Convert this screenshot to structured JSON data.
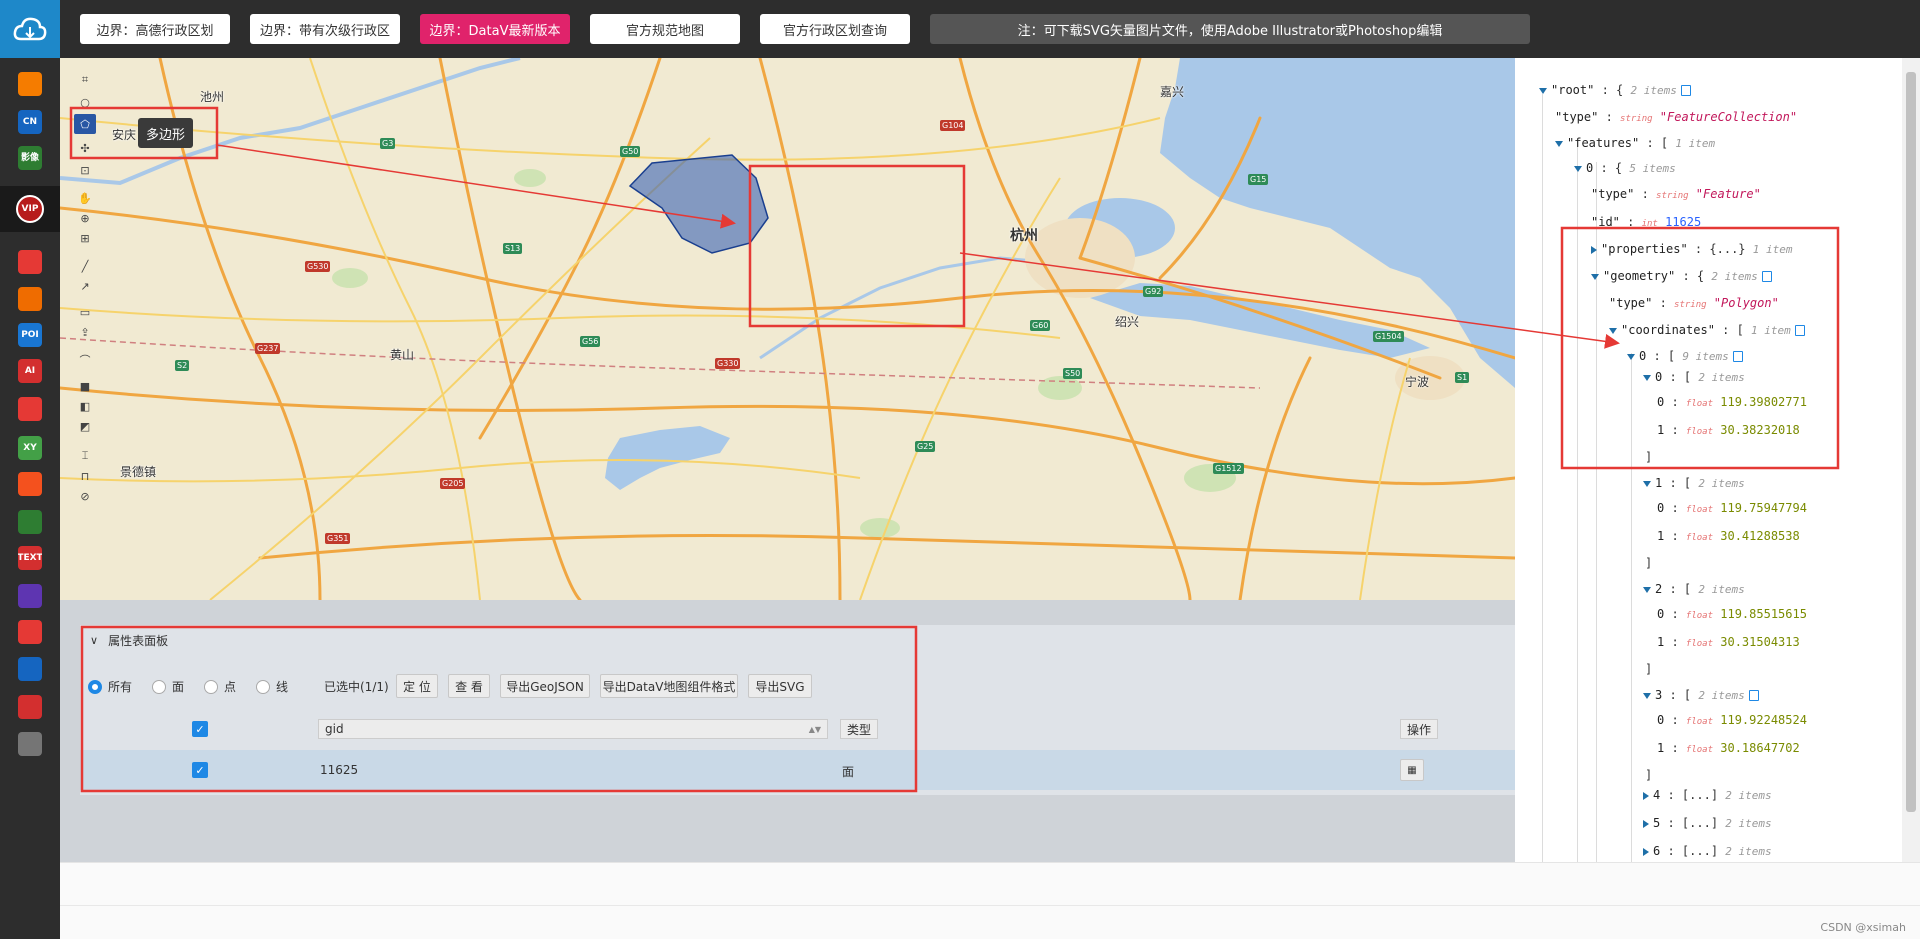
{
  "colors": {
    "accent": "#e0236b",
    "highlight": "#e53935",
    "polygon": "#2f5ea8",
    "sidebar": "#2d2d2d"
  },
  "sidebar": {
    "items": [
      {
        "icon": "home-icon",
        "label": "",
        "color": "#f57c00"
      },
      {
        "icon": "cn-map-icon",
        "label": "CN",
        "color": "#1565c0"
      },
      {
        "icon": "satellite-icon",
        "label": "影像",
        "color": "#2e7d32"
      },
      {
        "icon": "search-icon",
        "label": "",
        "color": "#e53935"
      },
      {
        "icon": "china-map-icon",
        "label": "",
        "color": "#ef6c00"
      },
      {
        "icon": "poi-icon",
        "label": "POI",
        "color": "#1976d2"
      },
      {
        "icon": "ai-icon",
        "label": "AI",
        "color": "#d32f2f"
      },
      {
        "icon": "pie-chart-icon",
        "label": "",
        "color": "#e53935"
      },
      {
        "icon": "xy-icon",
        "label": "XY",
        "color": "#43a047"
      },
      {
        "icon": "bulb-icon",
        "label": "",
        "color": "#f4511e"
      },
      {
        "icon": "road-icon",
        "label": "",
        "color": "#2e7d32"
      },
      {
        "icon": "text-icon",
        "label": "TEXT",
        "color": "#d32f2f"
      },
      {
        "icon": "color-wheel-icon",
        "label": "",
        "color": "#5e35b1"
      },
      {
        "icon": "stamp-icon",
        "label": "",
        "color": "#e53935"
      },
      {
        "icon": "bar-icon",
        "label": "",
        "color": "#1565c0"
      },
      {
        "icon": "edit-icon",
        "label": "",
        "color": "#d32f2f"
      },
      {
        "icon": "terminal-icon",
        "label": "",
        "color": "#757575"
      }
    ],
    "vip": "VIP"
  },
  "topbar": {
    "buttons": [
      "边界：高德行政区划",
      "边界：带有次级行政区",
      "边界：DataV最新版本",
      "官方规范地图",
      "官方行政区划查询"
    ],
    "note": "注：可下载SVG矢量图片文件，使用Adobe Illustrator或Photoshop编辑"
  },
  "map": {
    "tooltip": "多边形",
    "cities": [
      {
        "name": "池州",
        "big": false
      },
      {
        "name": "安庆",
        "big": false
      },
      {
        "name": "黄山",
        "big": false
      },
      {
        "name": "景德镇",
        "big": false
      },
      {
        "name": "杭州",
        "big": true
      },
      {
        "name": "绍兴",
        "big": false
      },
      {
        "name": "宁波",
        "big": false
      },
      {
        "name": "嘉兴",
        "big": false
      }
    ],
    "road_tags": [
      "G50",
      "G3",
      "G56",
      "G60",
      "G15",
      "G25",
      "G92",
      "G104",
      "G330",
      "S1",
      "S13",
      "S50",
      "G237",
      "G530",
      "G351",
      "G1512",
      "G1504",
      "G205",
      "S2"
    ]
  },
  "attr_panel": {
    "title": "属性表面板",
    "filters": [
      "所有",
      "面",
      "点",
      "线"
    ],
    "selected": "已选中(1/1)",
    "buttons": [
      "定 位",
      "查 看",
      "导出GeoJSON",
      "导出DataV地图组件格式",
      "导出SVG"
    ],
    "columns": {
      "gid": "gid",
      "type": "类型",
      "action": "操作"
    },
    "row": {
      "gid": "11625",
      "type": "面"
    }
  },
  "json_tree": {
    "root": {
      "key": "\"root\"",
      "count": "2 items"
    },
    "type": {
      "key": "\"type\"",
      "t": "string",
      "value": "\"FeatureCollection\""
    },
    "features": {
      "key": "\"features\"",
      "count": "1 item"
    },
    "f0": {
      "key": "0",
      "count": "5 items"
    },
    "ftype": {
      "key": "\"type\"",
      "t": "string",
      "value": "\"Feature\""
    },
    "fid": {
      "key": "\"id\"",
      "t": "int",
      "value": "11625"
    },
    "properties": {
      "key": "\"properties\"",
      "collapsed": "{...}",
      "count": "1 item"
    },
    "geometry": {
      "key": "\"geometry\"",
      "count": "2 items"
    },
    "gtype": {
      "key": "\"type\"",
      "t": "string",
      "value": "\"Polygon\""
    },
    "coordinates": {
      "key": "\"coordinates\"",
      "count": "1 item"
    },
    "ring": {
      "key": "0",
      "count": "9 items"
    },
    "points": [
      {
        "key": "0",
        "count": "2 items",
        "x": "119.39802771",
        "y": "30.38232018"
      },
      {
        "key": "1",
        "count": "2 items",
        "x": "119.75947794",
        "y": "30.41288538"
      },
      {
        "key": "2",
        "count": "2 items",
        "x": "119.85515615",
        "y": "30.31504313"
      },
      {
        "key": "3",
        "count": "2 items",
        "x": "119.92248524",
        "y": "30.18647702"
      }
    ],
    "collapsed_points": [
      {
        "key": "4",
        "value": "[...]",
        "count": "2 items"
      },
      {
        "key": "5",
        "value": "[...]",
        "count": "2 items"
      },
      {
        "key": "6",
        "value": "[...]",
        "count": "2 items"
      }
    ],
    "float_t": "float"
  },
  "footer": {
    "credit": "CSDN @xsimah"
  }
}
